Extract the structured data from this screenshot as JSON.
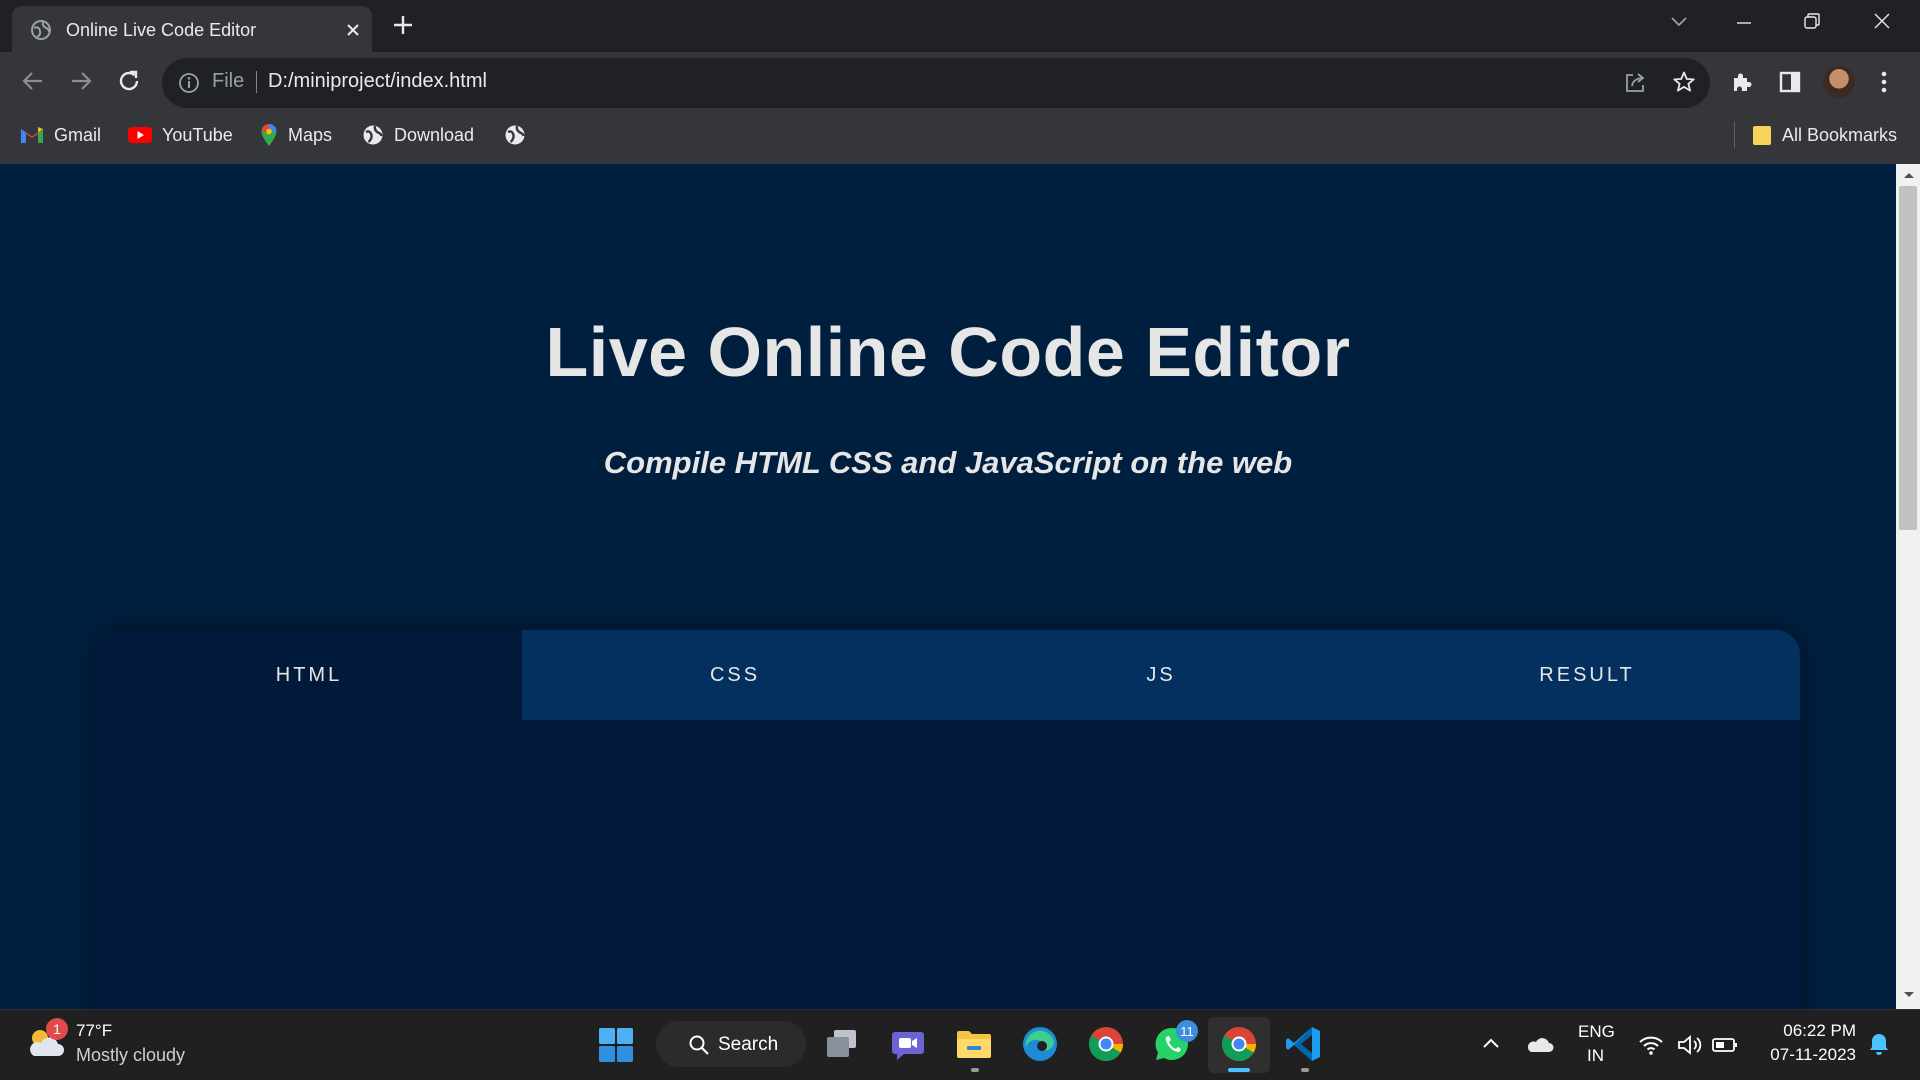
{
  "browser": {
    "tab": {
      "title": "Online Live Code Editor"
    },
    "address_bar": {
      "scheme_label": "File",
      "url": "D:/miniproject/index.html"
    },
    "bookmarks": [
      {
        "label": "Gmail",
        "icon": "gmail-icon"
      },
      {
        "label": "YouTube",
        "icon": "youtube-icon"
      },
      {
        "label": "Maps",
        "icon": "maps-icon"
      },
      {
        "label": "Download",
        "icon": "globe-icon"
      },
      {
        "label": "",
        "icon": "globe-icon"
      }
    ],
    "all_bookmarks_label": "All Bookmarks"
  },
  "page": {
    "heading": "Live Online Code Editor",
    "subheading": "Compile HTML CSS and JavaScript on the web",
    "tabs": [
      {
        "label": "HTML",
        "active": true
      },
      {
        "label": "CSS",
        "active": false
      },
      {
        "label": "JS",
        "active": false
      },
      {
        "label": "RESULT",
        "active": false
      }
    ]
  },
  "taskbar": {
    "weather": {
      "temp": "77°F",
      "condition": "Mostly cloudy",
      "badge": "1"
    },
    "search_label": "Search",
    "whatsapp_badge": "11",
    "language": {
      "line1": "ENG",
      "line2": "IN"
    },
    "clock": {
      "time": "06:22 PM",
      "date": "07-11-2023"
    }
  },
  "colors": {
    "page_background": "#001f3f",
    "tab_inactive": "#03305f",
    "editor_background": "#011a3c",
    "heading_text": "#e6e6e6"
  }
}
